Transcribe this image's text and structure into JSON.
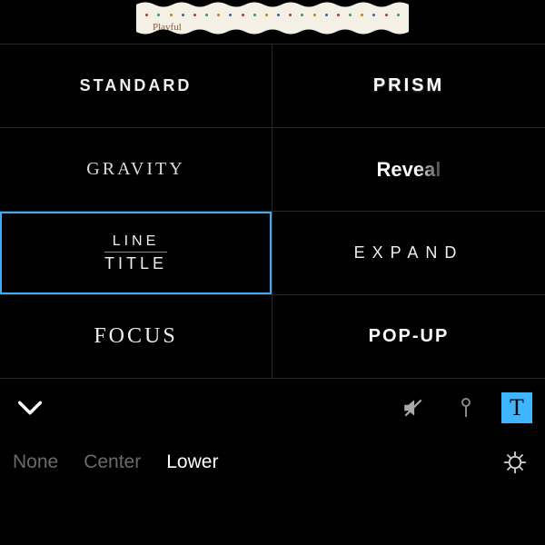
{
  "preview": {
    "label": "Playful"
  },
  "styles": [
    {
      "id": "standard",
      "label": "STANDARD"
    },
    {
      "id": "prism",
      "label": "PRISM"
    },
    {
      "id": "gravity",
      "label": "GRAVITY"
    },
    {
      "id": "reveal",
      "label": "Reveal"
    },
    {
      "id": "line-title",
      "line1": "LINE",
      "line2": "TITLE"
    },
    {
      "id": "expand",
      "label": "EXPAND"
    },
    {
      "id": "focus",
      "label": "FOCUS"
    },
    {
      "id": "popup",
      "label": "POP-UP"
    }
  ],
  "selected_style": "line-title",
  "toolbar": {
    "text_tool_glyph": "T"
  },
  "position": {
    "options": [
      "None",
      "Center",
      "Lower"
    ],
    "selected": "Lower"
  }
}
